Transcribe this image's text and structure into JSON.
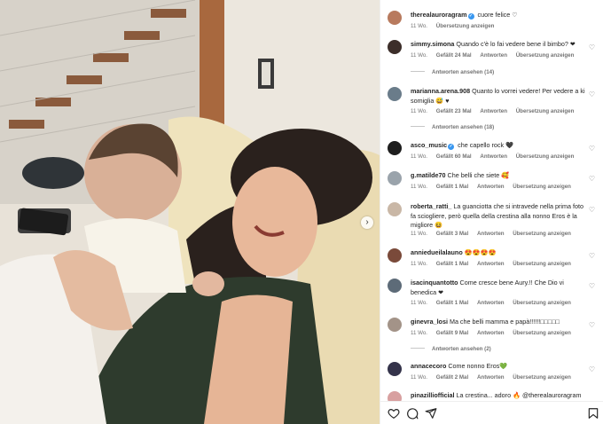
{
  "post": {
    "author": "therealauroragram",
    "caption": "cuore felice ♡",
    "time": "11 Wo.",
    "translate": "Übersetzung anzeigen"
  },
  "labels": {
    "reply": "Antworten",
    "translate": "Übersetzung anzeigen"
  },
  "comments": [
    {
      "user": "simmy.simona",
      "text": "Quando c'è lo fai vedere bene il bimbo? ❤",
      "time": "11 Wo.",
      "likes": "Gefällt 24 Mal",
      "replies": "Antworten ansehen (14)"
    },
    {
      "user": "marianna.arena.908",
      "text": "Quanto lo vorrei vedere! Per vedere a ki somiglia 😅 ♥",
      "time": "11 Wo.",
      "likes": "Gefällt 23 Mal",
      "replies": "Antworten ansehen (18)"
    },
    {
      "user": "asco_music",
      "text": "che capello rock 🖤",
      "time": "11 Wo.",
      "likes": "Gefällt 60 Mal",
      "verified": true
    },
    {
      "user": "g.matilde70",
      "text": "Che belli che siete 🥰",
      "time": "11 Wo.",
      "likes": "Gefällt 1 Mal"
    },
    {
      "user": "roberta_ratti_",
      "text": "La guanciotta che si intravede nella prima foto fa sciogliere, però quella della crestina alla nonno Eros è la migliore 😆",
      "time": "11 Wo.",
      "likes": "Gefällt 3 Mal"
    },
    {
      "user": "anniedueilalauno",
      "text": "😍😍😍😍",
      "time": "11 Wo.",
      "likes": "Gefällt 1 Mal"
    },
    {
      "user": "isacinquantotto",
      "text": "Come cresce bene Aury.!! Che Dio vi benedica ❤",
      "time": "11 Wo.",
      "likes": "Gefällt 1 Mal"
    },
    {
      "user": "ginevra_losi",
      "text": "Ma che belli mamma e papà!!!!!!□□□□□",
      "time": "11 Wo.",
      "likes": "Gefällt 9 Mal",
      "replies": "Antworten ansehen (2)"
    },
    {
      "user": "annacecoro",
      "text": "Come nonno Eros💚",
      "time": "11 Wo.",
      "likes": "Gefällt 2 Mal"
    },
    {
      "user": "pinazilliofficial",
      "text": "La crestina... adoro 🔥 @therealauroragram",
      "time": "",
      "likes": ""
    }
  ],
  "icons": {
    "like": "heart-icon",
    "comment": "comment-icon",
    "share": "send-icon",
    "save": "bookmark-icon",
    "next": "chevron-right-icon"
  },
  "colors": {
    "verified": "#3897f0",
    "like_red": "#ed4956",
    "meta": "#737373"
  }
}
